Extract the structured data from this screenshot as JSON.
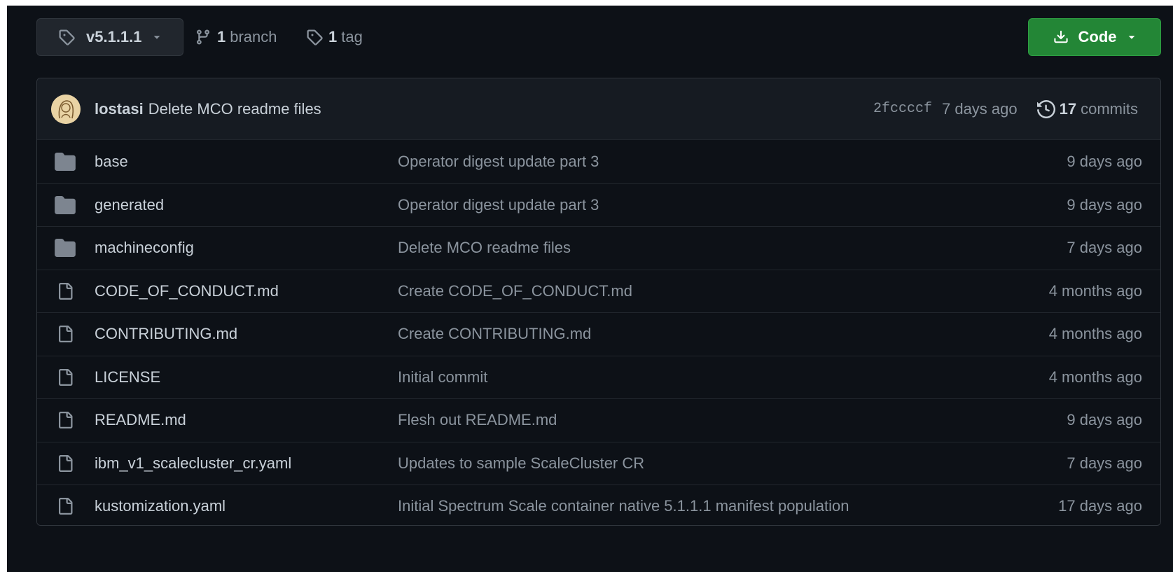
{
  "toolbar": {
    "branch_label": "v5.1.1.1",
    "branches_count": "1",
    "branches_label": "branch",
    "tags_count": "1",
    "tags_label": "tag",
    "code_label": "Code"
  },
  "latest_commit": {
    "author": "lostasi",
    "message": "Delete MCO readme files",
    "sha": "2fccccf",
    "age": "7 days ago",
    "commits_count": "17",
    "commits_label": "commits"
  },
  "files": [
    {
      "type": "folder",
      "name": "base",
      "message": "Operator digest update part 3",
      "age": "9 days ago"
    },
    {
      "type": "folder",
      "name": "generated",
      "message": "Operator digest update part 3",
      "age": "9 days ago"
    },
    {
      "type": "folder",
      "name": "machineconfig",
      "message": "Delete MCO readme files",
      "age": "7 days ago"
    },
    {
      "type": "file",
      "name": "CODE_OF_CONDUCT.md",
      "message": "Create CODE_OF_CONDUCT.md",
      "age": "4 months ago"
    },
    {
      "type": "file",
      "name": "CONTRIBUTING.md",
      "message": "Create CONTRIBUTING.md",
      "age": "4 months ago"
    },
    {
      "type": "file",
      "name": "LICENSE",
      "message": "Initial commit",
      "age": "4 months ago"
    },
    {
      "type": "file",
      "name": "README.md",
      "message": "Flesh out README.md",
      "age": "9 days ago"
    },
    {
      "type": "file",
      "name": "ibm_v1_scalecluster_cr.yaml",
      "message": "Updates to sample ScaleCluster CR",
      "age": "7 days ago"
    },
    {
      "type": "file",
      "name": "kustomization.yaml",
      "message": "Initial Spectrum Scale container native 5.1.1.1 manifest population",
      "age": "17 days ago"
    }
  ],
  "colors": {
    "background": "#0d1117",
    "header": "#161b22",
    "border": "#30363d",
    "primary_button": "#238636",
    "text": "#c9d1d9",
    "muted": "#8b949e",
    "folder_icon": "#7d8590"
  },
  "icons": {
    "tag": "tag-icon",
    "branch": "git-branch-icon",
    "download": "download-icon",
    "history": "history-icon",
    "folder": "folder-icon",
    "file": "file-icon",
    "caret": "caret-down-icon"
  }
}
